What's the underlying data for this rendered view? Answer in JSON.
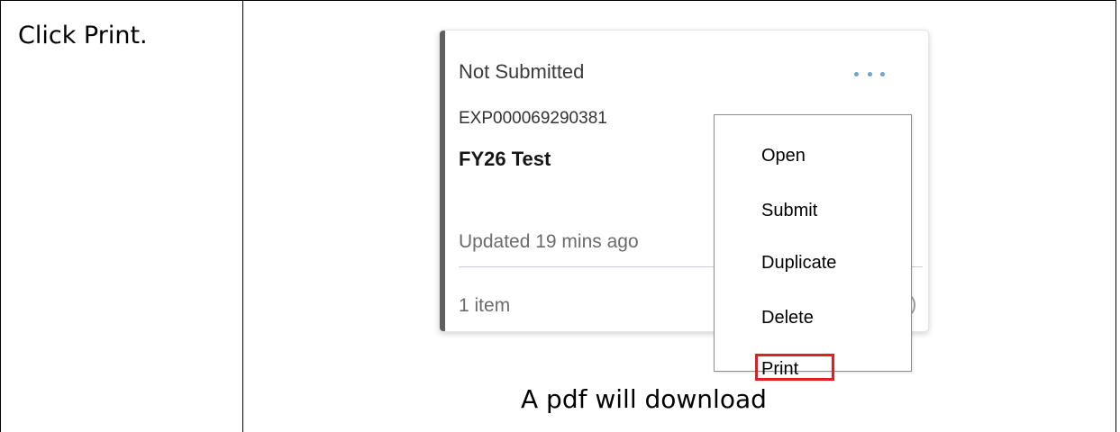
{
  "step": {
    "instruction": "Click Print.",
    "caption": "A pdf will download"
  },
  "card": {
    "status": "Not Submitted",
    "report_id": "EXP000069290381",
    "title": "FY26 Test",
    "updated": "Updated 19 mins ago",
    "item_count": "1 item",
    "more_icon": "ellipsis-icon"
  },
  "menu": {
    "items": [
      {
        "label": "Open"
      },
      {
        "label": "Submit"
      },
      {
        "label": "Duplicate"
      },
      {
        "label": "Delete"
      },
      {
        "label": "Print"
      }
    ],
    "highlighted": "Print"
  },
  "colors": {
    "accent_bar": "#5f5f5f",
    "more_dots": "#6ea3d6",
    "highlight": "#e02020"
  }
}
